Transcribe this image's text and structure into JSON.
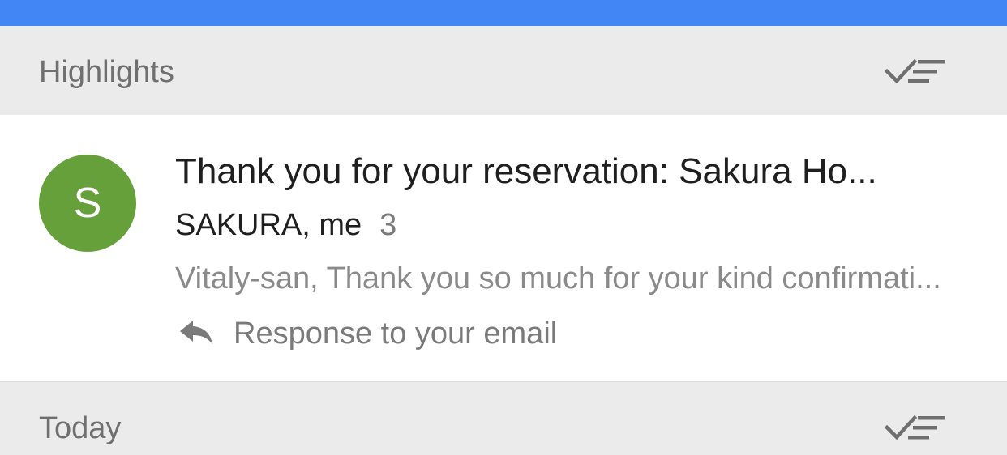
{
  "colors": {
    "top_bar": "#4285f4",
    "avatar_bg": "#66a03a",
    "icon_gray": "#6f6f6f"
  },
  "sections": [
    {
      "title": "Highlights",
      "action_icon": "sweep-done-icon"
    },
    {
      "title": "Today",
      "action_icon": "sweep-done-icon"
    }
  ],
  "email": {
    "avatar_letter": "S",
    "subject": "Thank you for your reservation: Sakura Ho...",
    "senders": "SAKURA, me",
    "message_count": "3",
    "snippet": "Vitaly-san, Thank you so much for your kind confirmati...",
    "status_icon": "reply-icon",
    "status_text": "Response to your email"
  }
}
